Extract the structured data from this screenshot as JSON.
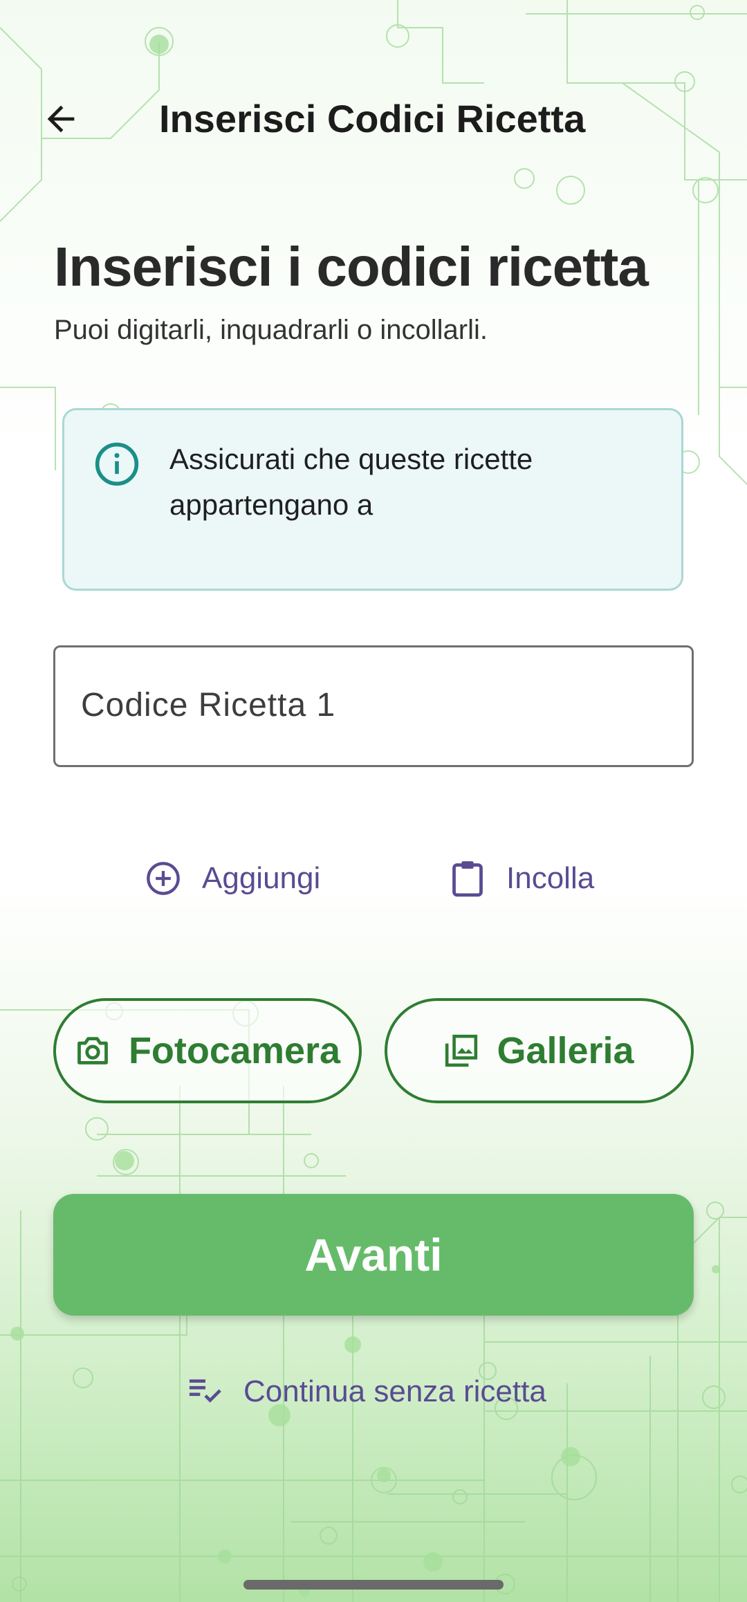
{
  "appbar": {
    "title": "Inserisci Codici Ricetta"
  },
  "header": {
    "title": "Inserisci i codici ricetta",
    "subtitle": "Puoi digitarli, inquadrarli o incollarli."
  },
  "info": {
    "text": "Assicurati che queste ricette appartengano a"
  },
  "code_field": {
    "label": "Codice Ricetta 1",
    "value": ""
  },
  "actions": {
    "add_label": "Aggiungi",
    "paste_label": "Incolla"
  },
  "capture": {
    "camera_label": "Fotocamera",
    "gallery_label": "Galleria"
  },
  "next_label": "Avanti",
  "skip_label": "Continua senza ricetta",
  "icons": {
    "back": "arrow-back-icon",
    "info": "info-icon",
    "add": "add-circle-icon",
    "paste": "clipboard-icon",
    "camera": "camera-icon",
    "gallery": "gallery-icon",
    "skip": "playlist-check-icon"
  },
  "colors": {
    "primary": "#66bb6a",
    "outline_green": "#2e7d32",
    "link_purple": "#5a4b92",
    "info_bg": "#ecf7f7",
    "info_border": "#a9d8d4",
    "info_icon": "#1a8f8a"
  }
}
